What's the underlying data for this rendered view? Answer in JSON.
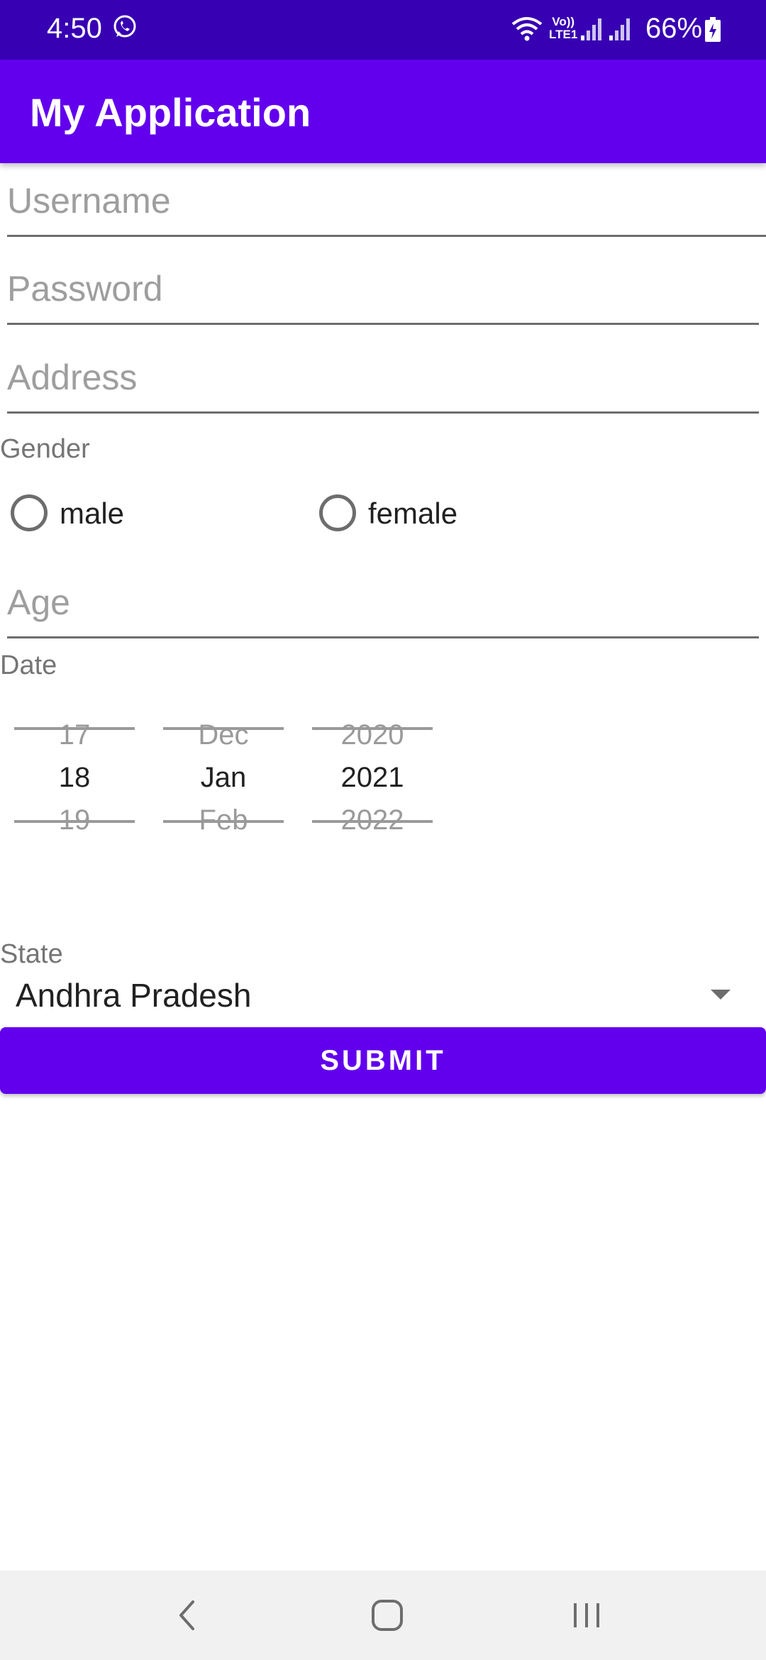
{
  "status_bar": {
    "time": "4:50",
    "volte_label_top": "Vo))",
    "volte_label_bottom": "LTE1",
    "battery": "66%",
    "icons": [
      "whatsapp-icon",
      "wifi-icon",
      "volte-icon",
      "signal-icon",
      "signal-icon",
      "battery-icon"
    ]
  },
  "app_bar": {
    "title": "My Application"
  },
  "form": {
    "username_placeholder": "Username",
    "password_placeholder": "Password",
    "address_placeholder": "Address",
    "gender_label": "Gender",
    "gender_options": [
      {
        "label": "male",
        "selected": false
      },
      {
        "label": "female",
        "selected": false
      }
    ],
    "age_placeholder": "Age",
    "date_label": "Date",
    "date_picker": {
      "day": {
        "prev": "17",
        "selected": "18",
        "next": "19"
      },
      "month": {
        "prev": "Dec",
        "selected": "Jan",
        "next": "Feb"
      },
      "year": {
        "prev": "2020",
        "selected": "2021",
        "next": "2022"
      }
    },
    "state_label": "State",
    "state_value": "Andhra Pradesh",
    "submit_label": "SUBMIT"
  },
  "nav_bar": {
    "icons": [
      "back-icon",
      "home-icon",
      "recents-icon"
    ]
  },
  "colors": {
    "status_bar": "#3700b3",
    "primary": "#6200ee",
    "hint_text": "#9e9e9e",
    "underline": "#6d6d6d"
  }
}
